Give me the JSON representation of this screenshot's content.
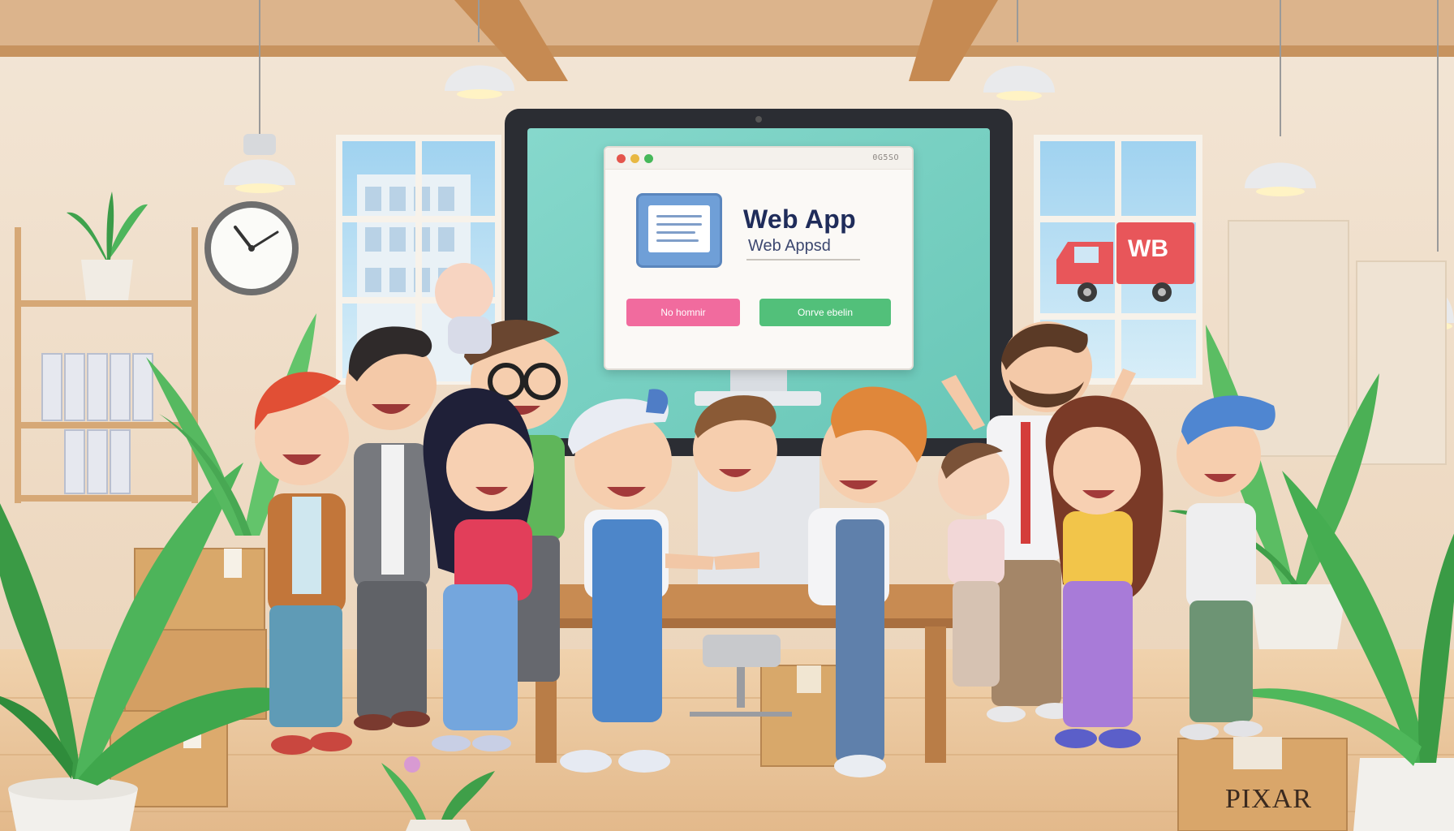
{
  "app_window": {
    "titlebar_text": "0G5SO",
    "title": "Web App",
    "subtitle": "Web Appsd",
    "left_button_label": "No homnir",
    "right_button_label": "Onrve ebelin"
  },
  "truck_sign": "WB",
  "box_label": "PIXAR",
  "colors": {
    "screen": "#7fd3c6",
    "wall": "#f1dfca",
    "floor": "#eac9a3",
    "wood": "#c78a52",
    "pink_button": "#f16b9e",
    "green_button": "#52c07a"
  }
}
